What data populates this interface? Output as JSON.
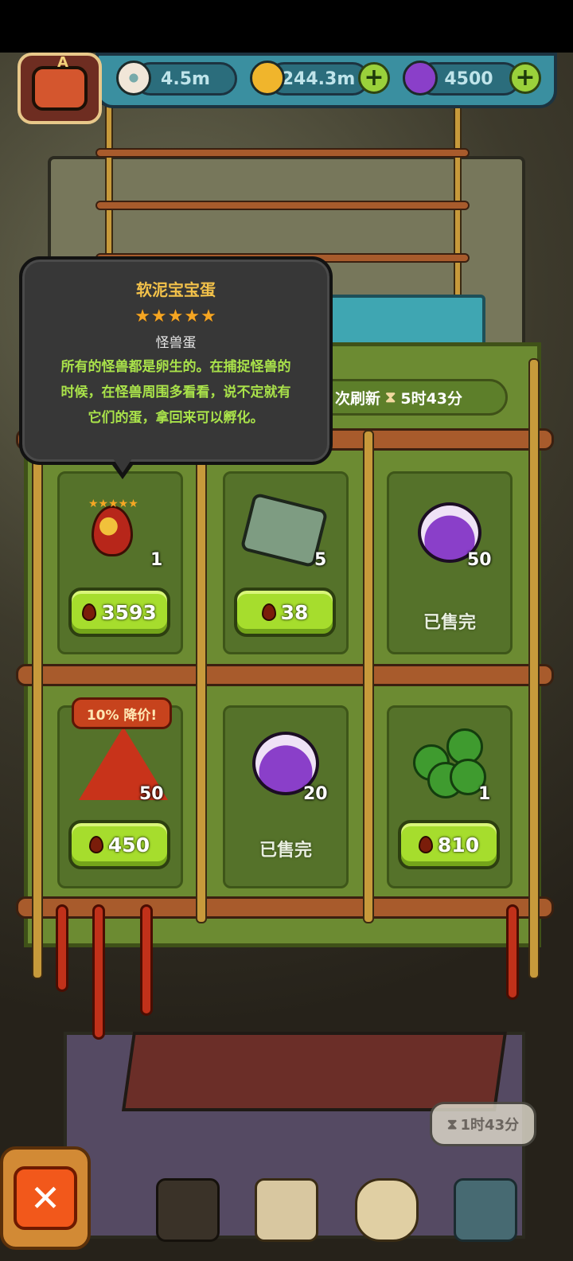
{
  "resources": {
    "eye_value": "4.5m",
    "coin_value": "244.3m",
    "potion_value": "4500"
  },
  "avatar_badge": "A",
  "shop": {
    "refresh_label": "次刷新",
    "refresh_timer": "5时43分",
    "items": [
      {
        "icon": "egg-icon",
        "count": "1",
        "price": "3593",
        "sold_out": false
      },
      {
        "icon": "map-icon",
        "count": "5",
        "price": "38",
        "sold_out": false
      },
      {
        "icon": "purple-potion-icon",
        "count": "50",
        "status": "已售完",
        "sold_out": true
      },
      {
        "icon": "red-crystal-icon",
        "count": "50",
        "price": "450",
        "sold_out": false,
        "discount": "10% 降价!"
      },
      {
        "icon": "purple-potion-icon",
        "count": "20",
        "status": "已售完",
        "sold_out": true
      },
      {
        "icon": "clover-icon",
        "count": "1",
        "price": "810",
        "sold_out": false
      }
    ]
  },
  "tooltip": {
    "title": "软泥宝宝蛋",
    "stars": "★★★★★",
    "type": "怪兽蛋",
    "desc_line1": "所有的怪兽都是卵生的。在捕捉怪兽的",
    "desc_line2": "时候，在怪兽周围多看看，说不定就有",
    "desc_line3": "它们的蛋，拿回来可以孵化。"
  },
  "bubble_timer": "1时43分",
  "colors": {
    "tooltip_title": "#f2c14a",
    "tooltip_desc": "#a9e24a",
    "button_green": "#a6dd2d"
  }
}
